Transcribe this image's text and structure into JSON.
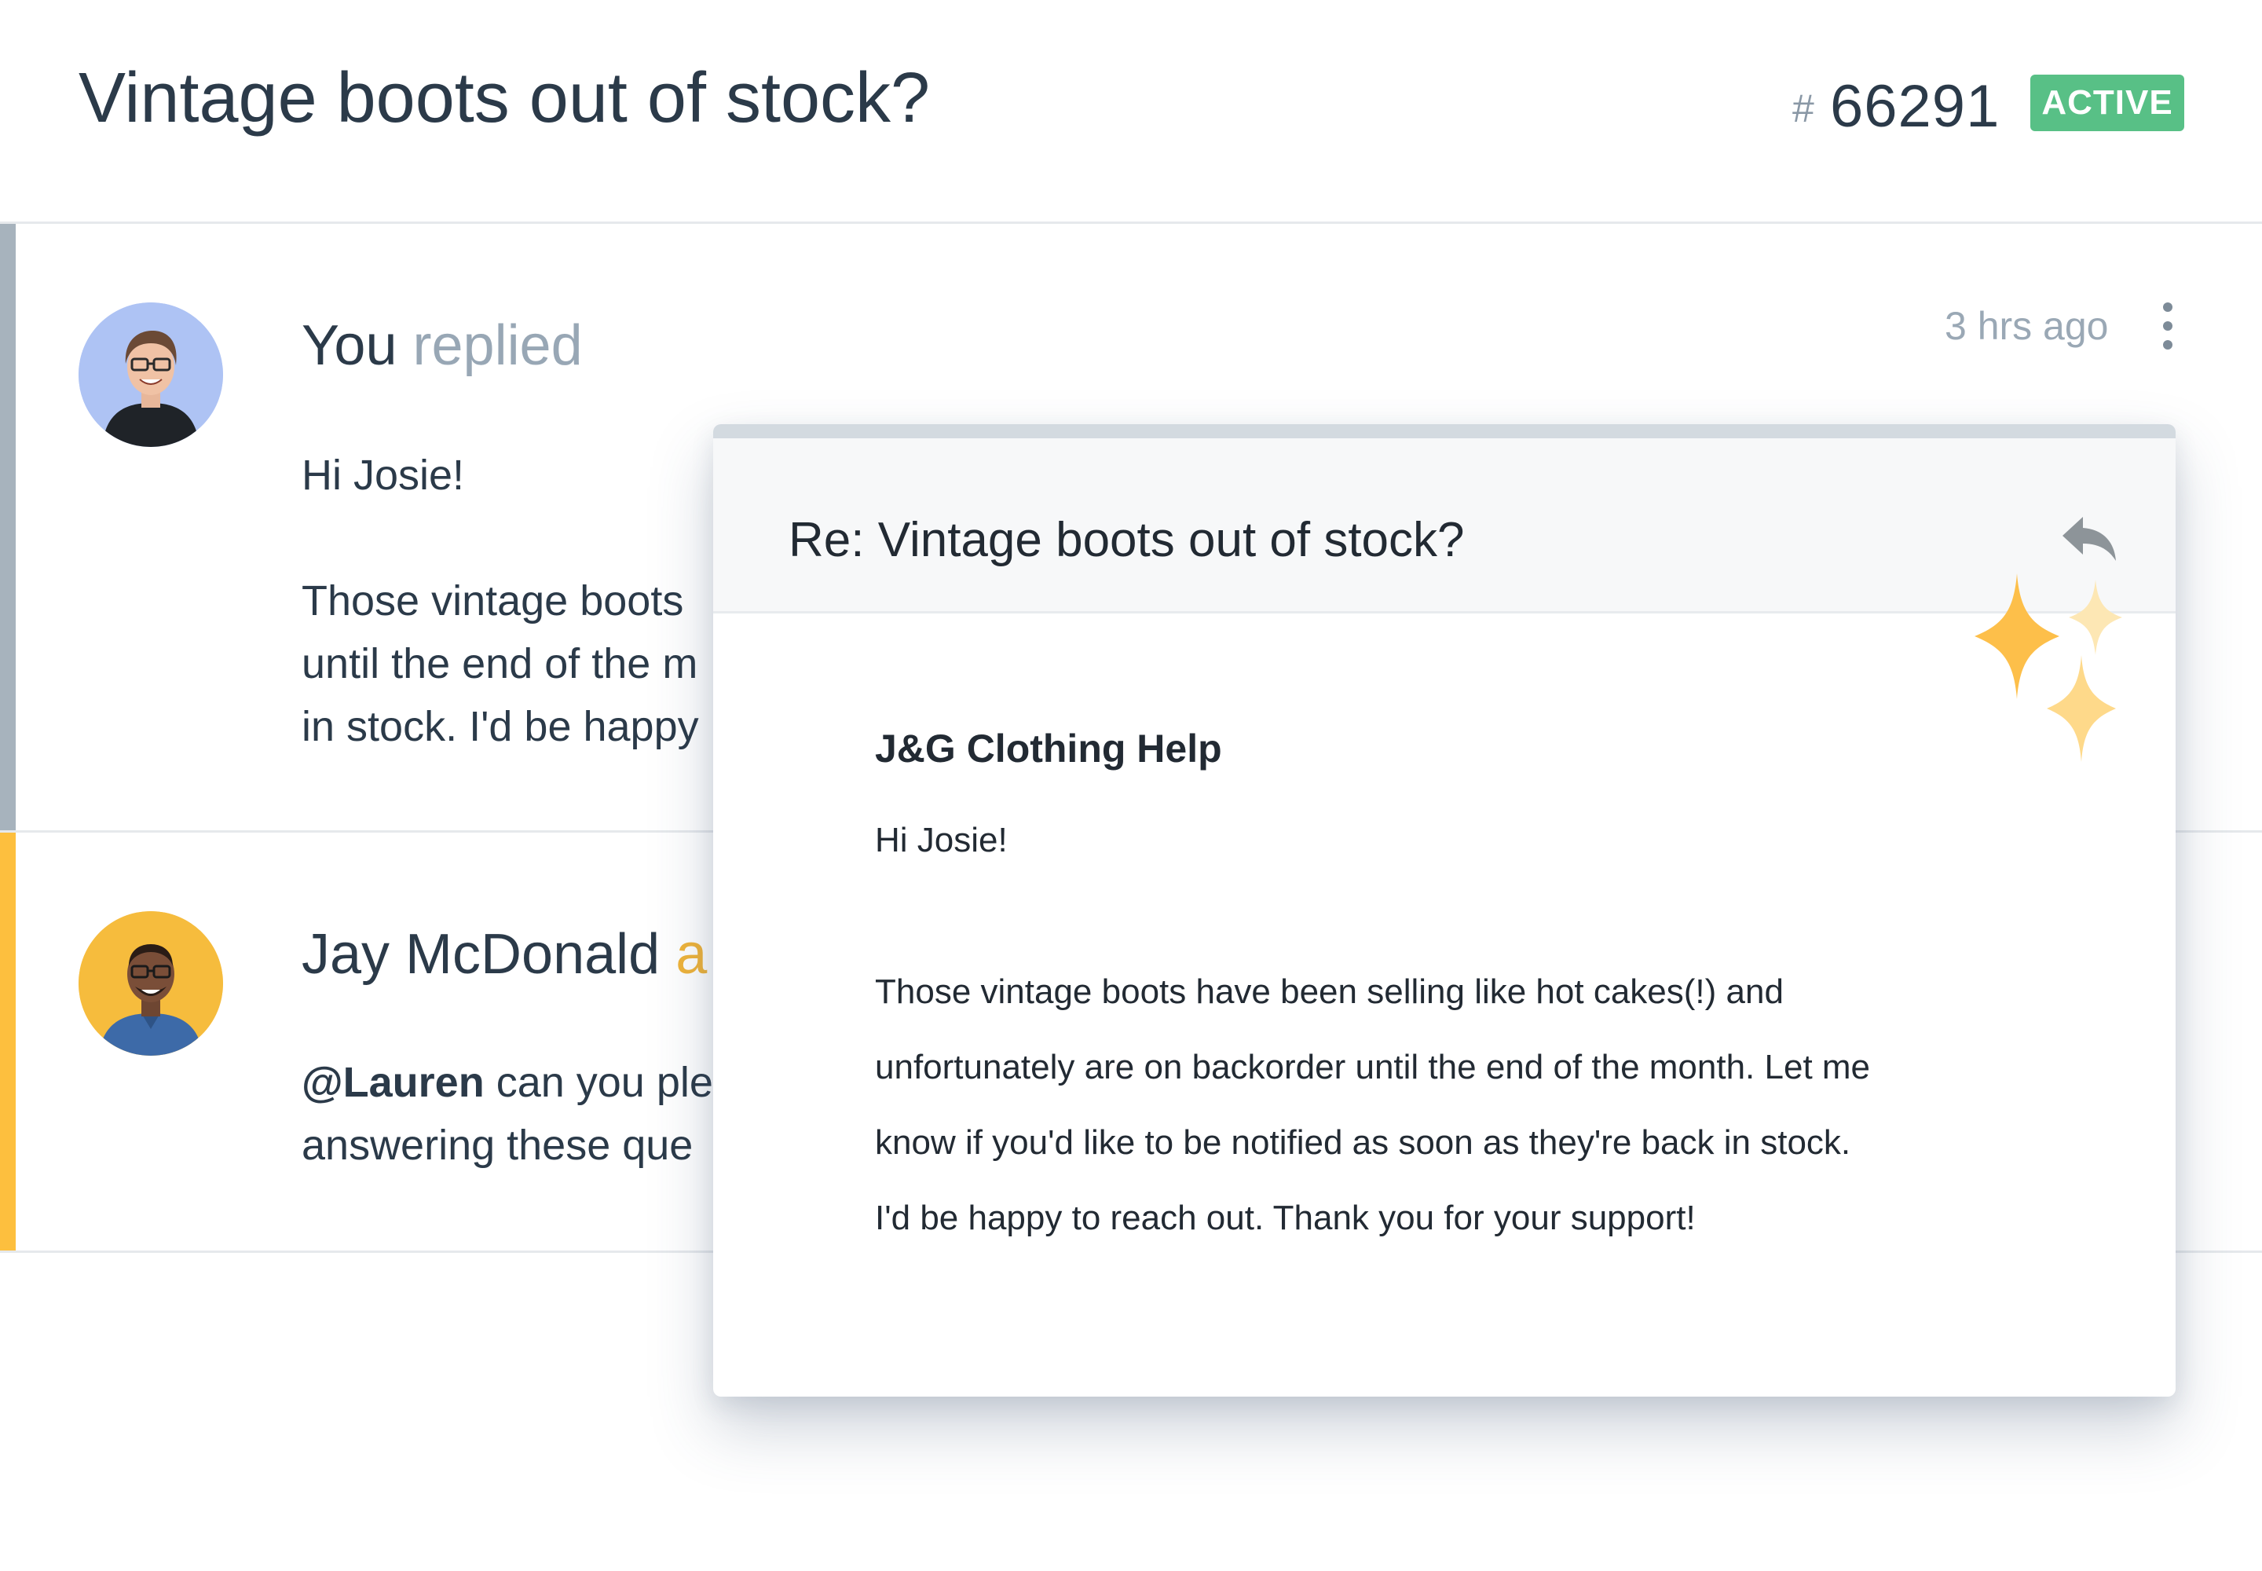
{
  "header": {
    "title": "Vintage boots out of stock?",
    "ticket_hash": "#",
    "ticket_number": "66291",
    "status": "ACTIVE"
  },
  "threads": [
    {
      "author": "You",
      "action": " replied",
      "time": "3 hrs ago",
      "lines": [
        "Hi Josie!",
        "Those vintage boots",
        "until the end of the m",
        "in stock. I'd be happy"
      ]
    },
    {
      "author": "Jay McDonald",
      "action": " a",
      "mention": "@Lauren",
      "line1_rest": " can you ple",
      "line2": "answering these que"
    }
  ],
  "email": {
    "subject": "Re: Vintage boots out of stock?",
    "from": "J&G Clothing Help",
    "greeting": "Hi Josie!",
    "lines": [
      "Those vintage boots have been selling like hot cakes(!) and",
      "unfortunately are on backorder until the end of the month. Let me",
      "know if you'd like to be notified as soon as they're back in stock.",
      "I'd be happy to reach out. Thank you for your support!"
    ]
  },
  "icons": {
    "reply": "reply-arrow-icon",
    "more": "kebab-menu-icon",
    "sparkle": "sparkle-icon"
  },
  "colors": {
    "active_badge": "#58c086",
    "accent_gray": "#a7b3bd",
    "accent_yellow": "#fdbf3e",
    "sparkle": "#fdbf4a"
  }
}
